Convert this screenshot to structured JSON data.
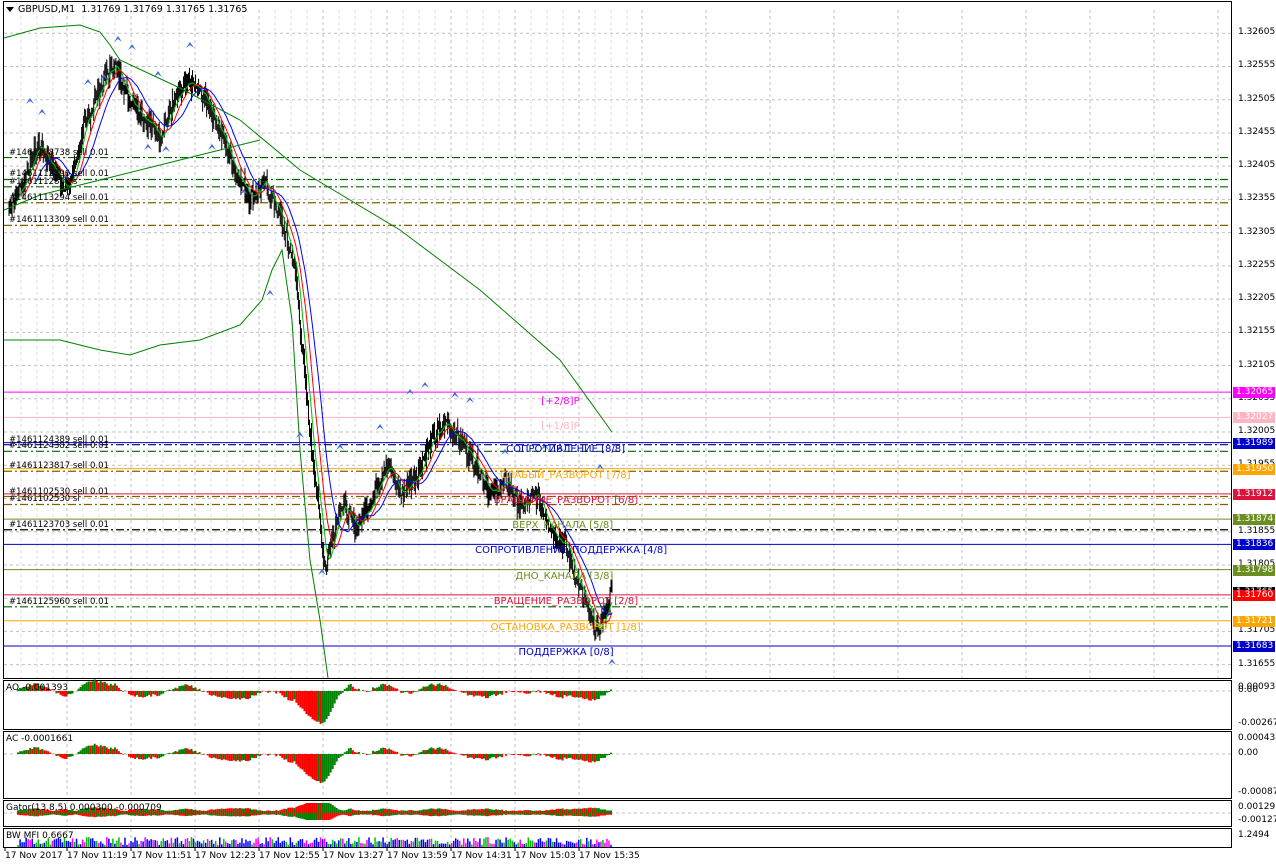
{
  "window": {
    "symbol_label": "GBPUSD,M1",
    "ohlc": "1.31769 1.31769 1.31765 1.31765",
    "icon": "dropdown-triangle-icon"
  },
  "price_axis": {
    "labels": [
      "1.32605",
      "1.32555",
      "1.32505",
      "1.32455",
      "1.32405",
      "1.32355",
      "1.32305",
      "1.32255",
      "1.32205",
      "1.32155",
      "1.32105",
      "1.32055",
      "1.32005",
      "1.31955",
      "1.31905",
      "1.31855",
      "1.31805",
      "1.31755",
      "1.31705",
      "1.31655"
    ],
    "range": [
      1.3165,
      1.3264
    ]
  },
  "price_tags": [
    {
      "text": "1.32065",
      "price": 1.32065,
      "color": "#ff00ff"
    },
    {
      "text": "1.32027",
      "price": 1.32027,
      "color": "#ffb6c1"
    },
    {
      "text": "1.31989",
      "price": 1.31989,
      "color": "#0000cd"
    },
    {
      "text": "1.31950",
      "price": 1.3195,
      "color": "#ffa500"
    },
    {
      "text": "1.31912",
      "price": 1.31912,
      "color": "#dc143c"
    },
    {
      "text": "1.31874",
      "price": 1.31874,
      "color": "#6b8e23"
    },
    {
      "text": "1.31836",
      "price": 1.31836,
      "color": "#0000cd"
    },
    {
      "text": "1.31798",
      "price": 1.31798,
      "color": "#6b8e23"
    },
    {
      "text": "1.31765",
      "price": 1.31765,
      "color": "#000000"
    },
    {
      "text": "1.31760",
      "price": 1.3176,
      "color": "#ff0000"
    },
    {
      "text": "1.31721",
      "price": 1.31721,
      "color": "#ffa500"
    },
    {
      "text": "1.31683",
      "price": 1.31683,
      "color": "#0000cd"
    }
  ],
  "murrey_levels": [
    {
      "label": "[+2/8]P",
      "price": 1.32065,
      "color": "#ff00ff"
    },
    {
      "label": "[+1/8]P",
      "price": 1.32027,
      "color": "#ffb6c1"
    },
    {
      "label": "СОПРОТИВЛЕНИЕ [8/8]",
      "price": 1.31989,
      "color": "#0000cd"
    },
    {
      "label": "СЛАБЫЙ_РАЗВОРОТ [7/8]",
      "price": 1.3195,
      "color": "#ffa500"
    },
    {
      "label": "ВРАЩЕНИЕ_РАЗВОРОТ [6/8]",
      "price": 1.31912,
      "color": "#dc143c"
    },
    {
      "label": "ВЕРХ_КАНАЛА [5/8]",
      "price": 1.31874,
      "color": "#6b8e23"
    },
    {
      "label": "СОПРОТИВЛЕНИЕ_ПОДДЕРЖКА [4/8]",
      "price": 1.31836,
      "color": "#0000cd"
    },
    {
      "label": "ДНО_КАНАЛА [3/8]",
      "price": 1.31798,
      "color": "#6b8e23"
    },
    {
      "label": "ВРАЩЕНИЕ_РАЗВОРОТ [2/8]",
      "price": 1.3176,
      "color": "#dc143c"
    },
    {
      "label": "ОСТАНОВКА_РАЗВОРОТ [1/8]",
      "price": 1.31721,
      "color": "#ffa500"
    },
    {
      "label": "ПОДДЕРЖКА [0/8]",
      "price": 1.31683,
      "color": "#0000cd"
    }
  ],
  "orders": [
    {
      "label": "#1461108738 sell 0.01",
      "price": 1.32418,
      "color": "#006400"
    },
    {
      "label": "#1461112896 sell 0.01",
      "price": 1.32385,
      "color": "#006400"
    },
    {
      "label": "#1461112817 s",
      "price": 1.32374,
      "color": "#006400"
    },
    {
      "label": "#1461113294 sell 0.01",
      "price": 1.3235,
      "color": "#806000"
    },
    {
      "label": "#1461113309 sell 0.01",
      "price": 1.32316,
      "color": "#806000"
    },
    {
      "label": "#1461124389 sell 0.01",
      "price": 1.31986,
      "color": "#000080"
    },
    {
      "label": "#1461124382 sell 0.01",
      "price": 1.31976,
      "color": "#006400"
    },
    {
      "label": "#1461123817 sell 0.01",
      "price": 1.31946,
      "color": "#806000"
    },
    {
      "label": "#1461102530 sell 0.01",
      "price": 1.31908,
      "color": "#806000"
    },
    {
      "label": "#1461102530 sl",
      "price": 1.31896,
      "color": "#806000"
    },
    {
      "label": "#1461123703 sell 0.01",
      "price": 1.31858,
      "color": "#000000"
    },
    {
      "label": "#1461125960 sell 0.01",
      "price": 1.31742,
      "color": "#006400"
    }
  ],
  "indicators": [
    {
      "key": "ao",
      "title": "AO -0.001393",
      "axis_labels": [
        "0.000936",
        "0.00",
        "-0.002679"
      ]
    },
    {
      "key": "ac",
      "title": "AC -0.0001661",
      "axis_labels": [
        "0.000438",
        "0.00",
        "-0.000872"
      ]
    },
    {
      "key": "gator",
      "title": "Gator(13,8,5) 0.000300 -0.000709",
      "axis_labels": [
        "0.001297",
        "-0.001275"
      ]
    },
    {
      "key": "mfi",
      "title": "BW MFI 0.6667",
      "axis_labels": [
        "1.2494"
      ]
    }
  ],
  "time_axis": [
    "17 Nov 2017",
    "17 Nov 11:19",
    "17 Nov 11:51",
    "17 Nov 12:23",
    "17 Nov 12:55",
    "17 Nov 13:27",
    "17 Nov 13:59",
    "17 Nov 14:31",
    "17 Nov 15:03",
    "17 Nov 15:35"
  ],
  "colors": {
    "bull": "#008000",
    "bear": "#ff0000",
    "up_bar": "#00c000",
    "grid": "#c0c0c0",
    "fractal": "#4169e1"
  },
  "chart_data": {
    "type": "candlestick",
    "symbol": "GBPUSD",
    "timeframe": "M1",
    "close_path": [
      1.3234,
      1.3238,
      1.3244,
      1.324,
      1.3237,
      1.3246,
      1.3252,
      1.3256,
      1.3251,
      1.3248,
      1.3245,
      1.325,
      1.3253,
      1.3251,
      1.3246,
      1.324,
      1.3236,
      1.3238,
      1.3233,
      1.3225,
      1.32,
      1.318,
      1.319,
      1.3186,
      1.319,
      1.3196,
      1.3191,
      1.3194,
      1.3199,
      1.3202,
      1.3199,
      1.3196,
      1.3191,
      1.3193,
      1.3189,
      1.3191,
      1.3186,
      1.3183,
      1.3176,
      1.317,
      1.31765
    ],
    "indicator_last": {
      "AO": -0.001393,
      "AC": -0.0001661,
      "Gator_up": 0.0003,
      "Gator_down": -0.000709,
      "BW_MFI": 0.6667
    }
  }
}
